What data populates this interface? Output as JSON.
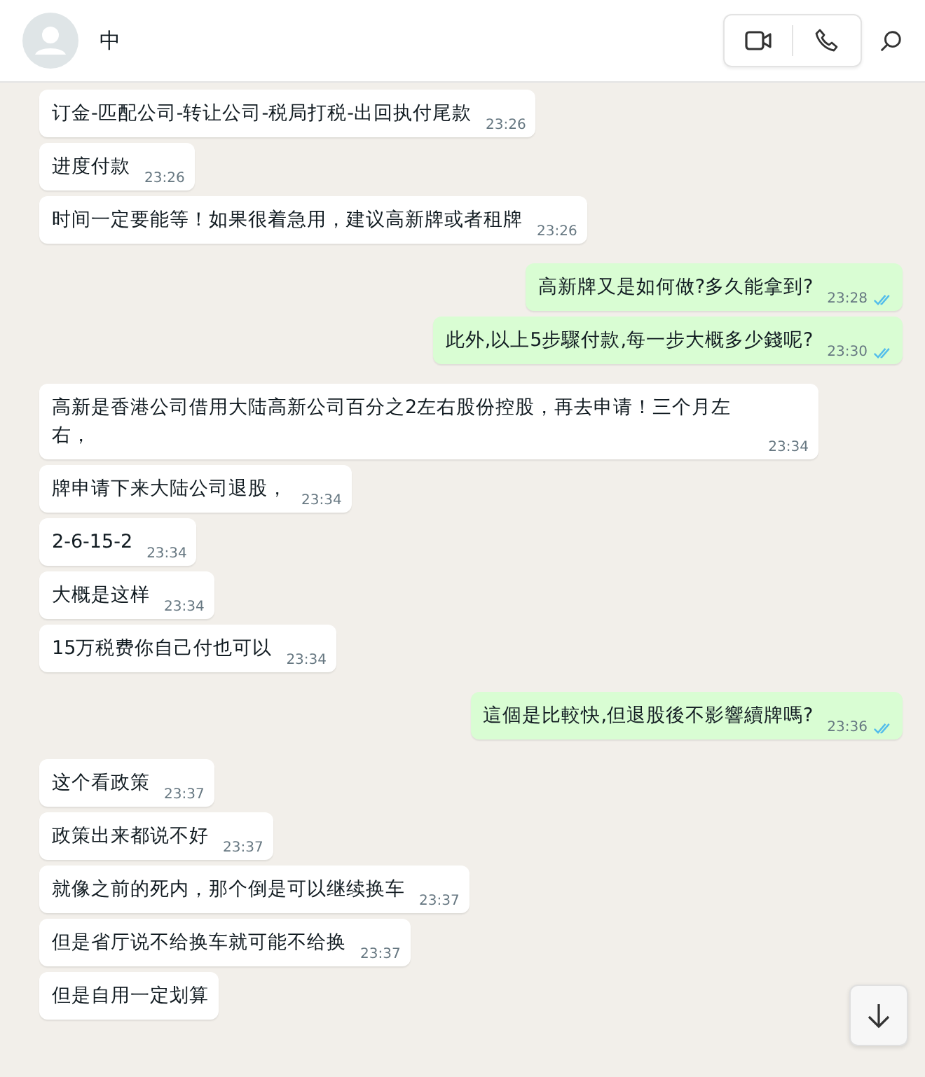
{
  "header": {
    "contact_name": "中"
  },
  "messages": [
    {
      "kind": "incoming",
      "text": "订金-匹配公司-转让公司-税局打税-出回执付尾款",
      "time": "23:26"
    },
    {
      "kind": "incoming",
      "text": "进度付款",
      "time": "23:26"
    },
    {
      "kind": "incoming",
      "text": "时间一定要能等！如果很着急用，建议高新牌或者租牌",
      "time": "23:26"
    },
    {
      "kind": "outgoing",
      "text": "高新牌又是如何做?多久能拿到?",
      "time": "23:28",
      "read": true
    },
    {
      "kind": "outgoing",
      "text": "此外,以上5步驟付款,每一步大概多少錢呢?",
      "time": "23:30",
      "read": true
    },
    {
      "kind": "incoming",
      "text": "高新是香港公司借用大陆高新公司百分之2左右股份控股，再去申请！三个月左右，",
      "time": "23:34"
    },
    {
      "kind": "incoming",
      "text": "牌申请下来大陆公司退股，",
      "time": "23:34"
    },
    {
      "kind": "incoming",
      "text": "2-6-15-2",
      "time": "23:34"
    },
    {
      "kind": "incoming",
      "text": "大概是这样",
      "time": "23:34"
    },
    {
      "kind": "incoming",
      "text": "15万税费你自己付也可以",
      "time": "23:34"
    },
    {
      "kind": "outgoing",
      "text": "這個是比較快,但退股後不影響續牌嗎?",
      "time": "23:36",
      "read": true
    },
    {
      "kind": "incoming",
      "text": "这个看政策",
      "time": "23:37"
    },
    {
      "kind": "incoming",
      "text": "政策出来都说不好",
      "time": "23:37"
    },
    {
      "kind": "incoming",
      "text": "就像之前的死内，那个倒是可以继续换车",
      "time": "23:37"
    },
    {
      "kind": "incoming",
      "text": "但是省厅说不给换车就可能不给换",
      "time": "23:37"
    },
    {
      "kind": "incoming",
      "text": "但是自用一定划算"
    }
  ]
}
